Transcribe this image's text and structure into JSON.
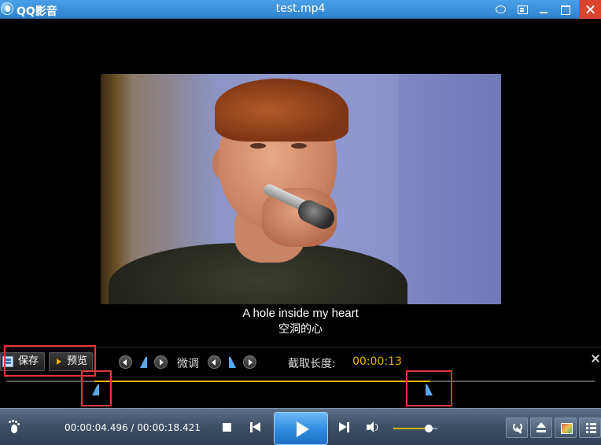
{
  "window": {
    "app_name": "QQ影音",
    "title": "test.mp4"
  },
  "video": {
    "subtitle_en": "A hole inside my heart",
    "subtitle_cn": "空洞的心"
  },
  "clip_toolbar": {
    "save_label": "保存",
    "preview_label": "预览",
    "fine_tune_label": "微调",
    "clip_length_label": "截取长度:",
    "clip_length_value": "00:00:13"
  },
  "player": {
    "time_readout": "00:00:04.496 / 00:00:18.421",
    "volume_level": 0.8
  },
  "colors": {
    "accent": "#e8b400",
    "marker": "#5aa8ee",
    "highlight_box": "#e8353a",
    "title_bar": "#2f83cf"
  },
  "icons": [
    "app-logo-icon",
    "chat-icon",
    "skin-icon",
    "minimize-icon",
    "maximize-icon",
    "close-icon",
    "save-icon",
    "play-icon",
    "arrow-left-icon",
    "arrow-right-icon",
    "clip-start-marker-icon",
    "clip-end-marker-icon",
    "footprint-icon",
    "stop-icon",
    "previous-icon",
    "next-icon",
    "volume-icon",
    "wrench-icon",
    "eject-icon",
    "screen-icon",
    "playlist-icon"
  ]
}
